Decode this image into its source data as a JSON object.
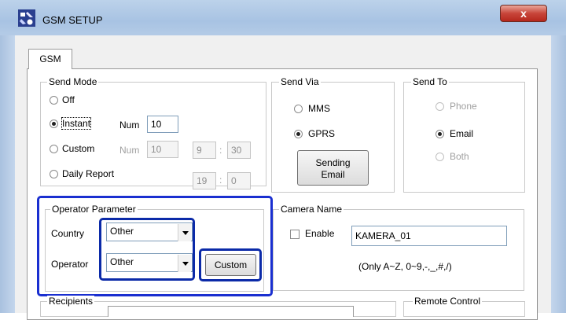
{
  "window": {
    "title": "GSM SETUP",
    "close_label": "x"
  },
  "tabs": [
    {
      "label": "GSM"
    }
  ],
  "send_mode": {
    "legend": "Send Mode",
    "off_label": "Off",
    "instant_label": "Instant",
    "instant_num_label": "Num",
    "instant_num_value": "10",
    "custom_label": "Custom",
    "custom_num_label": "Num",
    "custom_num_value": "10",
    "custom_hour": "9",
    "custom_minute": "30",
    "daily_label": "Daily Report",
    "daily_hour": "19",
    "daily_minute": "0",
    "time_sep": ":",
    "selected": "Instant"
  },
  "send_via": {
    "legend": "Send Via",
    "mms_label": "MMS",
    "gprs_label": "GPRS",
    "selected": "GPRS",
    "sending_email_line1": "Sending",
    "sending_email_line2": "Email"
  },
  "send_to": {
    "legend": "Send To",
    "phone_label": "Phone",
    "email_label": "Email",
    "both_label": "Both",
    "selected": "Email"
  },
  "operator_parameter": {
    "legend": "Operator Parameter",
    "country_label": "Country",
    "country_value": "Other",
    "operator_label": "Operator",
    "operator_value": "Other",
    "custom_button": "Custom"
  },
  "camera_name": {
    "legend": "Camera Name",
    "enable_label": "Enable",
    "enabled": false,
    "name_value": "KAMERA_01",
    "hint": "(Only A~Z, 0~9,-,_,#,/)"
  },
  "recipients": {
    "legend": "Recipients"
  },
  "remote_control": {
    "legend": "Remote Control"
  },
  "colors": {
    "highlight": "#1a2fd0",
    "close_button": "#c8453a",
    "titlebar": "#bcd2ea"
  }
}
